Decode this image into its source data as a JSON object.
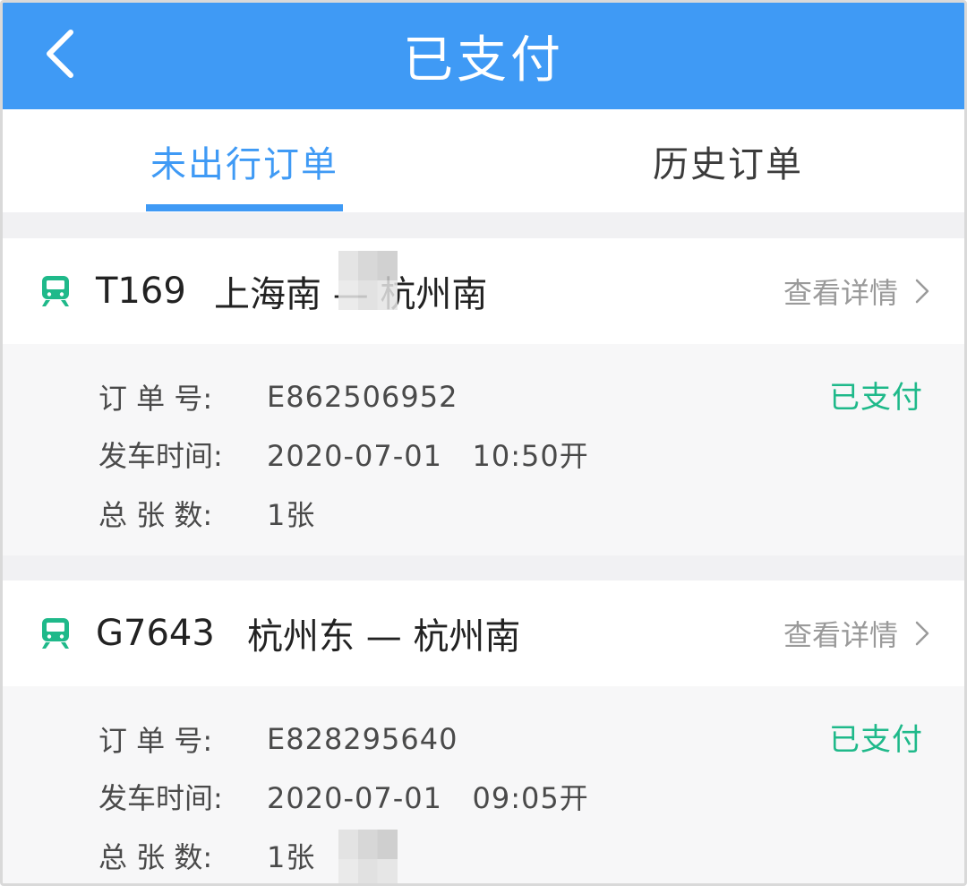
{
  "header": {
    "title": "已支付"
  },
  "tabs": [
    {
      "label": "未出行订单",
      "active": true
    },
    {
      "label": "历史订单",
      "active": false
    }
  ],
  "colors": {
    "primary": "#3f9af5",
    "train_green": "#1fb98a",
    "paid_green": "#1fb98a"
  },
  "orders": [
    {
      "train_no": "T169",
      "route": "上海南 — 杭州南",
      "detail_label": "查看详情",
      "status": "已支付",
      "order_label": "订 单 号:",
      "order_no": "E862506952",
      "depart_label": "发车时间:",
      "depart_time": "2020-07-01   10:50开",
      "count_label": "总 张 数:",
      "count": "1张"
    },
    {
      "train_no": "G7643",
      "route": "杭州东 — 杭州南",
      "detail_label": "查看详情",
      "status": "已支付",
      "order_label": "订 单 号:",
      "order_no": "E828295640",
      "depart_label": "发车时间:",
      "depart_time": "2020-07-01   09:05开",
      "count_label": "总 张 数:",
      "count": "1张"
    }
  ]
}
